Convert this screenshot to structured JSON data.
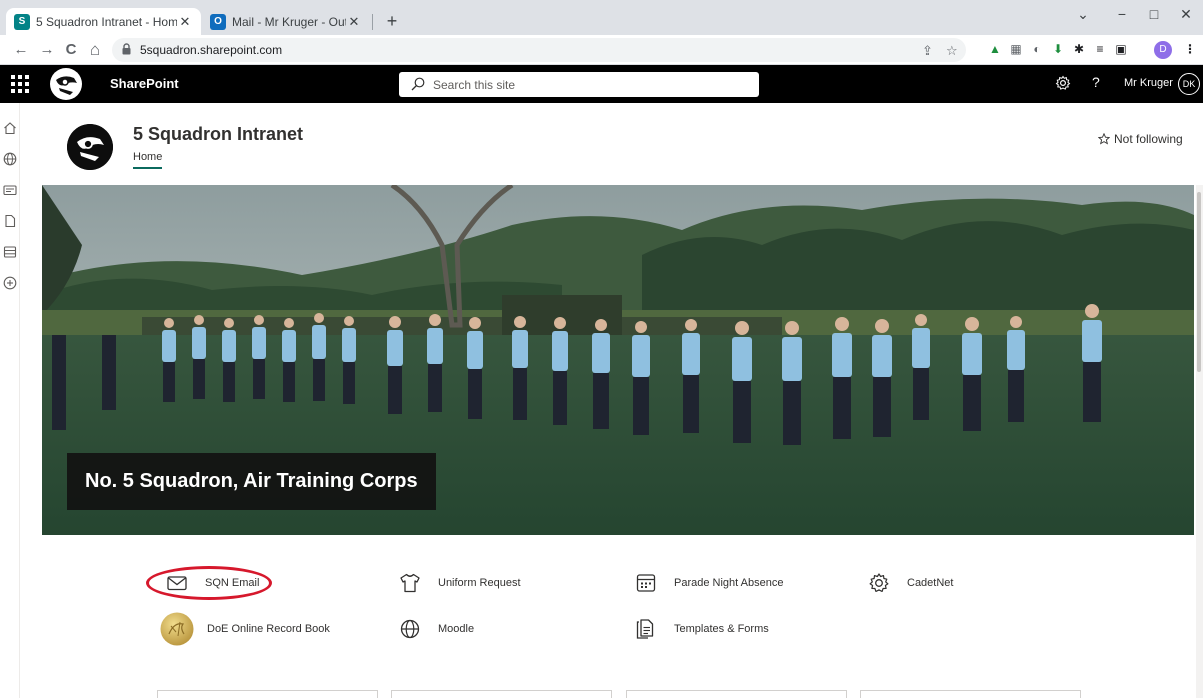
{
  "browser": {
    "tabs": [
      {
        "title": "5 Squadron Intranet - Home",
        "favicon": "sharepoint-icon",
        "favicon_color": "#038387",
        "active": true
      },
      {
        "title": "Mail - Mr Kruger - Outlook",
        "favicon": "outlook-icon",
        "favicon_color": "#0f6cbd",
        "active": false
      }
    ],
    "new_tab": "+",
    "url": "5squadron.sharepoint.com",
    "nav": {
      "back": "←",
      "forward": "→",
      "reload": "C",
      "home": "⌂"
    },
    "profile_initial": "D",
    "window": {
      "minimize": "−",
      "maximize": "□",
      "close": "✕",
      "tab_search": "⌄"
    }
  },
  "suite": {
    "brand": "SharePoint",
    "search_placeholder": "Search this site",
    "user_name": "Mr Kruger",
    "user_initials": "DK",
    "help": "?"
  },
  "site": {
    "title": "5 Squadron Intranet",
    "nav": [
      "Home"
    ],
    "follow_label": "Not following"
  },
  "hero": {
    "caption": "No. 5 Squadron, Air Training Corps"
  },
  "quick_links": [
    {
      "label": "SQN Email",
      "icon": "mail-icon"
    },
    {
      "label": "Uniform Request",
      "icon": "shirt-icon"
    },
    {
      "label": "Parade Night Absence",
      "icon": "calendar-icon"
    },
    {
      "label": "CadetNet",
      "icon": "gear-icon"
    },
    {
      "label": "DoE Online Record Book",
      "icon": "doe-badge-icon"
    },
    {
      "label": "Moodle",
      "icon": "globe-icon"
    },
    {
      "label": "Templates & Forms",
      "icon": "document-icon"
    }
  ],
  "colors": {
    "suite_bar": "#000000",
    "accent": "#0b6a5e",
    "annotation": "#d6182c"
  }
}
